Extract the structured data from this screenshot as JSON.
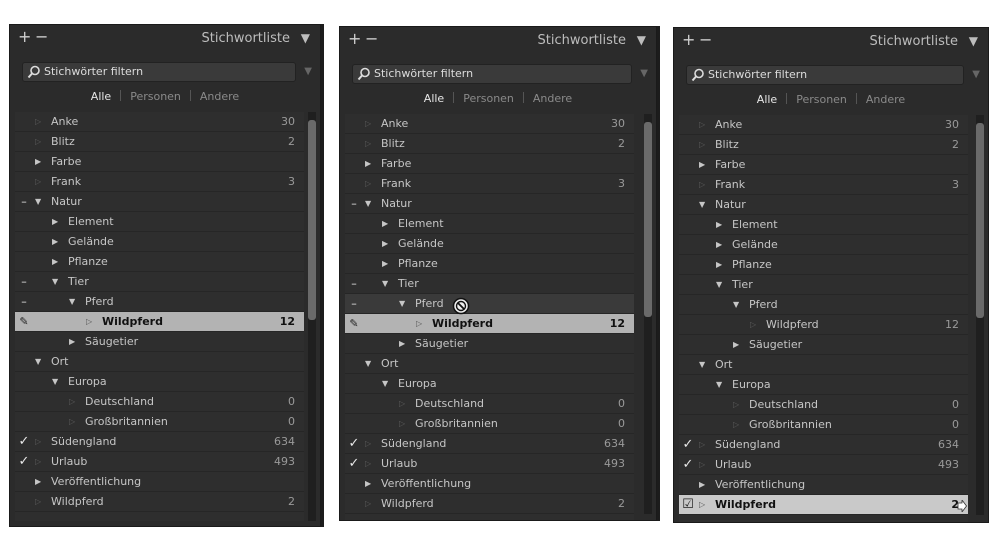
{
  "panel": {
    "title": "Stichwortliste",
    "plus_label": "+",
    "minus_label": "−",
    "menu_arrow": "▼",
    "filter_placeholder": "Stichwörter filtern",
    "filter_drop": "▼",
    "tabs": [
      "Alle",
      "Personen",
      "Andere"
    ],
    "active_tab": "Alle"
  },
  "panels": [
    {
      "state": "before-drag",
      "rows": [
        {
          "label": "Anke",
          "count": "30",
          "depth": 0,
          "tri": "leaf",
          "left": ""
        },
        {
          "label": "Blitz",
          "count": "2",
          "depth": 0,
          "tri": "leaf",
          "left": ""
        },
        {
          "label": "Farbe",
          "count": "",
          "depth": 0,
          "tri": "collapsed",
          "left": ""
        },
        {
          "label": "Frank",
          "count": "3",
          "depth": 0,
          "tri": "leaf",
          "left": ""
        },
        {
          "label": "Natur",
          "count": "",
          "depth": 0,
          "tri": "expanded",
          "left": "–"
        },
        {
          "label": "Element",
          "count": "",
          "depth": 1,
          "tri": "collapsed",
          "left": ""
        },
        {
          "label": "Gelände",
          "count": "",
          "depth": 1,
          "tri": "collapsed",
          "left": ""
        },
        {
          "label": "Pflanze",
          "count": "",
          "depth": 1,
          "tri": "collapsed",
          "left": ""
        },
        {
          "label": "Tier",
          "count": "",
          "depth": 1,
          "tri": "expanded",
          "left": "–"
        },
        {
          "label": "Pferd",
          "count": "",
          "depth": 2,
          "tri": "expanded",
          "left": "–"
        },
        {
          "label": "Wildpferd",
          "count": "12",
          "depth": 3,
          "tri": "leaf",
          "left": "✎",
          "state": "selected"
        },
        {
          "label": "Säugetier",
          "count": "",
          "depth": 2,
          "tri": "collapsed",
          "left": ""
        },
        {
          "label": "Ort",
          "count": "",
          "depth": 0,
          "tri": "expanded",
          "left": ""
        },
        {
          "label": "Europa",
          "count": "",
          "depth": 1,
          "tri": "expanded",
          "left": ""
        },
        {
          "label": "Deutschland",
          "count": "0",
          "depth": 2,
          "tri": "leaf",
          "left": ""
        },
        {
          "label": "Großbritannien",
          "count": "0",
          "depth": 2,
          "tri": "leaf",
          "left": ""
        },
        {
          "label": "Südengland",
          "count": "634",
          "depth": 0,
          "tri": "leaf",
          "left": "✓"
        },
        {
          "label": "Urlaub",
          "count": "493",
          "depth": 0,
          "tri": "leaf",
          "left": "✓"
        },
        {
          "label": "Veröffentlichung",
          "count": "",
          "depth": 0,
          "tri": "collapsed",
          "left": ""
        },
        {
          "label": "Wildpferd",
          "count": "2",
          "depth": 0,
          "tri": "leaf",
          "left": ""
        }
      ]
    },
    {
      "state": "dragging",
      "rows": [
        {
          "label": "Anke",
          "count": "30",
          "depth": 0,
          "tri": "leaf",
          "left": ""
        },
        {
          "label": "Blitz",
          "count": "2",
          "depth": 0,
          "tri": "leaf",
          "left": ""
        },
        {
          "label": "Farbe",
          "count": "",
          "depth": 0,
          "tri": "collapsed",
          "left": ""
        },
        {
          "label": "Frank",
          "count": "3",
          "depth": 0,
          "tri": "leaf",
          "left": ""
        },
        {
          "label": "Natur",
          "count": "",
          "depth": 0,
          "tri": "expanded",
          "left": "–"
        },
        {
          "label": "Element",
          "count": "",
          "depth": 1,
          "tri": "collapsed",
          "left": ""
        },
        {
          "label": "Gelände",
          "count": "",
          "depth": 1,
          "tri": "collapsed",
          "left": ""
        },
        {
          "label": "Pflanze",
          "count": "",
          "depth": 1,
          "tri": "collapsed",
          "left": ""
        },
        {
          "label": "Tier",
          "count": "",
          "depth": 1,
          "tri": "expanded",
          "left": "–"
        },
        {
          "label": "Pferd",
          "count": "",
          "depth": 2,
          "tri": "expanded",
          "left": "–",
          "state": "hovered"
        },
        {
          "label": "Wildpferd",
          "count": "12",
          "depth": 3,
          "tri": "leaf",
          "left": "✎",
          "state": "selected"
        },
        {
          "label": "Säugetier",
          "count": "",
          "depth": 2,
          "tri": "collapsed",
          "left": ""
        },
        {
          "label": "Ort",
          "count": "",
          "depth": 0,
          "tri": "expanded",
          "left": ""
        },
        {
          "label": "Europa",
          "count": "",
          "depth": 1,
          "tri": "expanded",
          "left": ""
        },
        {
          "label": "Deutschland",
          "count": "0",
          "depth": 2,
          "tri": "leaf",
          "left": ""
        },
        {
          "label": "Großbritannien",
          "count": "0",
          "depth": 2,
          "tri": "leaf",
          "left": ""
        },
        {
          "label": "Südengland",
          "count": "634",
          "depth": 0,
          "tri": "leaf",
          "left": "✓"
        },
        {
          "label": "Urlaub",
          "count": "493",
          "depth": 0,
          "tri": "leaf",
          "left": "✓"
        },
        {
          "label": "Veröffentlichung",
          "count": "",
          "depth": 0,
          "tri": "collapsed",
          "left": ""
        },
        {
          "label": "Wildpferd",
          "count": "2",
          "depth": 0,
          "tri": "leaf",
          "left": ""
        }
      ]
    },
    {
      "state": "after-drop",
      "rows": [
        {
          "label": "Anke",
          "count": "30",
          "depth": 0,
          "tri": "leaf",
          "left": ""
        },
        {
          "label": "Blitz",
          "count": "2",
          "depth": 0,
          "tri": "leaf",
          "left": ""
        },
        {
          "label": "Farbe",
          "count": "",
          "depth": 0,
          "tri": "collapsed",
          "left": ""
        },
        {
          "label": "Frank",
          "count": "3",
          "depth": 0,
          "tri": "leaf",
          "left": ""
        },
        {
          "label": "Natur",
          "count": "",
          "depth": 0,
          "tri": "expanded",
          "left": ""
        },
        {
          "label": "Element",
          "count": "",
          "depth": 1,
          "tri": "collapsed",
          "left": ""
        },
        {
          "label": "Gelände",
          "count": "",
          "depth": 1,
          "tri": "collapsed",
          "left": ""
        },
        {
          "label": "Pflanze",
          "count": "",
          "depth": 1,
          "tri": "collapsed",
          "left": ""
        },
        {
          "label": "Tier",
          "count": "",
          "depth": 1,
          "tri": "expanded",
          "left": ""
        },
        {
          "label": "Pferd",
          "count": "",
          "depth": 2,
          "tri": "expanded",
          "left": ""
        },
        {
          "label": "Wildpferd",
          "count": "12",
          "depth": 3,
          "tri": "leaf",
          "left": ""
        },
        {
          "label": "Säugetier",
          "count": "",
          "depth": 2,
          "tri": "collapsed",
          "left": ""
        },
        {
          "label": "Ort",
          "count": "",
          "depth": 0,
          "tri": "expanded",
          "left": ""
        },
        {
          "label": "Europa",
          "count": "",
          "depth": 1,
          "tri": "expanded",
          "left": ""
        },
        {
          "label": "Deutschland",
          "count": "0",
          "depth": 2,
          "tri": "leaf",
          "left": ""
        },
        {
          "label": "Großbritannien",
          "count": "0",
          "depth": 2,
          "tri": "leaf",
          "left": ""
        },
        {
          "label": "Südengland",
          "count": "634",
          "depth": 0,
          "tri": "leaf",
          "left": "✓"
        },
        {
          "label": "Urlaub",
          "count": "493",
          "depth": 0,
          "tri": "leaf",
          "left": "✓"
        },
        {
          "label": "Veröffentlichung",
          "count": "",
          "depth": 0,
          "tri": "collapsed",
          "left": ""
        },
        {
          "label": "Wildpferd",
          "count": "2",
          "depth": 0,
          "tri": "leaf",
          "left": "☑",
          "state": "highlight-bottom"
        }
      ]
    }
  ],
  "colors": {
    "panel_bg": "#2b2b2b",
    "list_bg": "#2e2e2e",
    "selected_row": "#b3b3b3",
    "text": "#c6c6c6",
    "count_text": "#9a9a9a"
  },
  "icons": {
    "search": "search-icon",
    "no_entry": "no-entry-cursor-icon",
    "drag_arrow": "drag-arrow-icon"
  }
}
